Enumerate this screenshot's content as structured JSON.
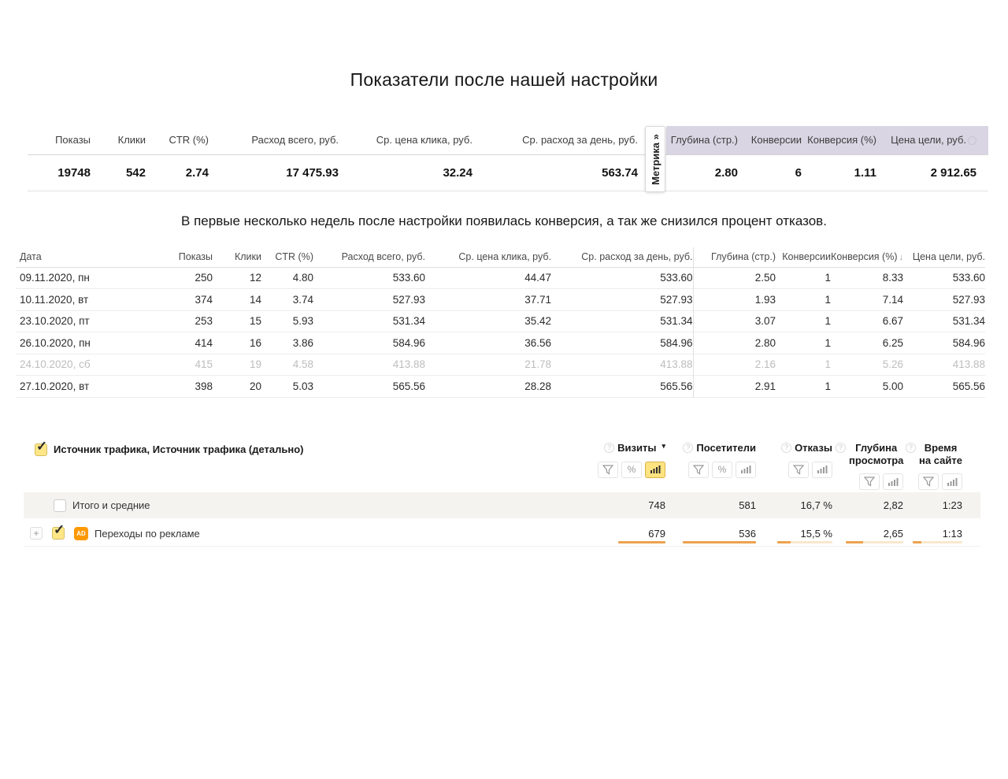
{
  "page": {
    "title": "Показатели после нашей настройки",
    "subtitle": "В первые несколько недель после настройки появилась конверсия, а так же снизился процент отказов."
  },
  "icons": {
    "checkmark": "✓",
    "plus": "+",
    "percent": "%",
    "question": "?",
    "dropdown": "▾",
    "sort_desc": "↓",
    "funnel": "filter-icon",
    "bar_chart": "chart-icon"
  },
  "colors": {
    "metrika_header_bg": "#d9d5e3",
    "checkbox_yellow": "#ffe787",
    "active_icon_yellow": "#ffe380",
    "ad_badge_orange": "#ff9900",
    "bar_orange": "#eda24f",
    "bar_pale": "#f8e8cd",
    "totals_row_bg": "#f4f3ef"
  },
  "summary": {
    "tab_label": "Метрика »",
    "columns": [
      {
        "label": "Показы",
        "value": "19748"
      },
      {
        "label": "Клики",
        "value": "542"
      },
      {
        "label": "CTR (%)",
        "value": "2.74"
      },
      {
        "label": "Расход всего, руб.",
        "value": "17 475.93"
      },
      {
        "label": "Ср. цена клика, руб.",
        "value": "32.24"
      },
      {
        "label": "Ср. расход за день, руб.",
        "value": "563.74"
      },
      {
        "label": "Глубина (стр.)",
        "value": "2.80"
      },
      {
        "label": "Конверсии",
        "value": "6"
      },
      {
        "label": "Конверсия (%)",
        "value": "1.11"
      },
      {
        "label": "Цена цели, руб.",
        "value": "2 912.65"
      }
    ]
  },
  "daily": {
    "columns": [
      "Дата",
      "Показы",
      "Клики",
      "CTR (%)",
      "Расход всего, руб.",
      "Ср. цена клика, руб.",
      "Ср. расход за день, руб.",
      "Глубина (стр.)",
      "Конверсии",
      "Конверсия (%)",
      "Цена цели, руб."
    ],
    "sorted_by": "Конверсия (%)",
    "rows": [
      {
        "muted": false,
        "cells": [
          "09.11.2020, пн",
          "250",
          "12",
          "4.80",
          "533.60",
          "44.47",
          "533.60",
          "2.50",
          "1",
          "8.33",
          "533.60"
        ]
      },
      {
        "muted": false,
        "cells": [
          "10.11.2020, вт",
          "374",
          "14",
          "3.74",
          "527.93",
          "37.71",
          "527.93",
          "1.93",
          "1",
          "7.14",
          "527.93"
        ]
      },
      {
        "muted": false,
        "cells": [
          "23.10.2020, пт",
          "253",
          "15",
          "5.93",
          "531.34",
          "35.42",
          "531.34",
          "3.07",
          "1",
          "6.67",
          "531.34"
        ]
      },
      {
        "muted": false,
        "cells": [
          "26.10.2020, пн",
          "414",
          "16",
          "3.86",
          "584.96",
          "36.56",
          "584.96",
          "2.80",
          "1",
          "6.25",
          "584.96"
        ]
      },
      {
        "muted": true,
        "cells": [
          "24.10.2020, сб",
          "415",
          "19",
          "4.58",
          "413.88",
          "21.78",
          "413.88",
          "2.16",
          "1",
          "5.26",
          "413.88"
        ]
      },
      {
        "muted": false,
        "cells": [
          "27.10.2020, вт",
          "398",
          "20",
          "5.03",
          "565.56",
          "28.28",
          "565.56",
          "2.91",
          "1",
          "5.00",
          "565.56"
        ]
      }
    ]
  },
  "panel": {
    "group_label": "Источник трафика, Источник трафика (детально)",
    "columns": [
      {
        "label": "Визиты",
        "has_dropdown": true,
        "icons": [
          "filter",
          "percent",
          "chart"
        ],
        "active_icon": "chart"
      },
      {
        "label": "Посетители",
        "icons": [
          "filter",
          "percent",
          "chart"
        ]
      },
      {
        "label": "Отказы",
        "icons": [
          "filter",
          "chart"
        ]
      },
      {
        "label": "Глубина просмотра",
        "icons": [
          "filter",
          "chart"
        ]
      },
      {
        "label": "Время на сайте",
        "icons": [
          "filter",
          "chart"
        ]
      }
    ],
    "rows": [
      {
        "label": "Итого и средние",
        "checked": false,
        "values": [
          "748",
          "581",
          "16,7 %",
          "2,82",
          "1:23"
        ]
      },
      {
        "label": "Переходы по рекламе",
        "checked": true,
        "badge": "AD",
        "values": [
          "679",
          "536",
          "15,5 %",
          "2,65",
          "1:13"
        ],
        "bar_fill": [
          100,
          100,
          24,
          30,
          18
        ]
      }
    ]
  }
}
